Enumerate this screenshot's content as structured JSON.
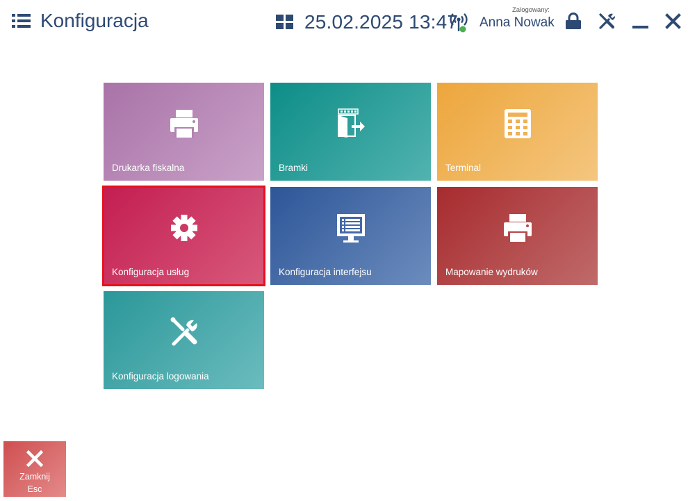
{
  "header": {
    "title": "Konfiguracja",
    "datetime": "25.02.2025 13:47",
    "logged_in_label": "Zalogowany:",
    "user_name": "Anna Nowak"
  },
  "tiles": [
    {
      "label": "Drukarka fiskalna",
      "icon": "printer-icon"
    },
    {
      "label": "Bramki",
      "icon": "gate-icon"
    },
    {
      "label": "Terminal",
      "icon": "calculator-icon"
    },
    {
      "label": "Konfiguracja usług",
      "icon": "gear-icon",
      "selected": true
    },
    {
      "label": "Konfiguracja interfejsu",
      "icon": "monitor-icon"
    },
    {
      "label": "Mapowanie wydruków",
      "icon": "printer-icon"
    },
    {
      "label": "Konfiguracja logowania",
      "icon": "tools-icon"
    }
  ],
  "footer": {
    "close_label": "Zamknij",
    "close_shortcut": "Esc"
  },
  "colors": {
    "accent_text": "#2e4a73",
    "selection_border": "#e8101b",
    "status_online": "#4caf50"
  }
}
